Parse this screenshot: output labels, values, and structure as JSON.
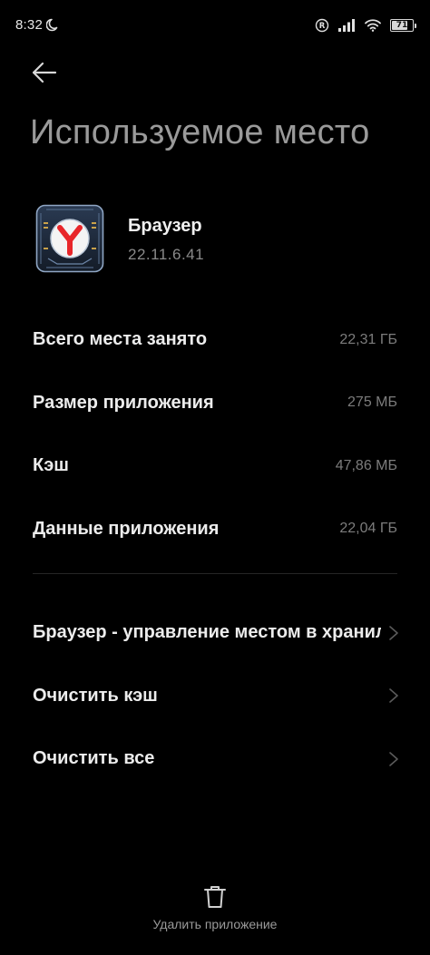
{
  "status_bar": {
    "time": "8:32",
    "battery_level": "71",
    "icons": [
      "moon-icon",
      "registered-icon",
      "signal-icon",
      "wifi-icon",
      "battery-icon"
    ]
  },
  "header": {
    "back_icon": "arrow-left-icon",
    "title": "Используемое место"
  },
  "app": {
    "name": "Браузер",
    "version": "22.11.6.41",
    "icon": "yandex-browser-logo",
    "accent_color": "#e8262a"
  },
  "storage": [
    {
      "label": "Всего места занято",
      "value": "22,31 ГБ"
    },
    {
      "label": "Размер приложения",
      "value": "275 МБ"
    },
    {
      "label": "Кэш",
      "value": "47,86 МБ"
    },
    {
      "label": "Данные приложения",
      "value": "22,04 ГБ"
    }
  ],
  "actions": [
    {
      "label": "Браузер - управление местом в хранилище"
    },
    {
      "label": "Очистить кэш"
    },
    {
      "label": "Очистить все"
    }
  ],
  "bottom": {
    "uninstall_label": "Удалить приложение",
    "icon": "trash-icon"
  }
}
